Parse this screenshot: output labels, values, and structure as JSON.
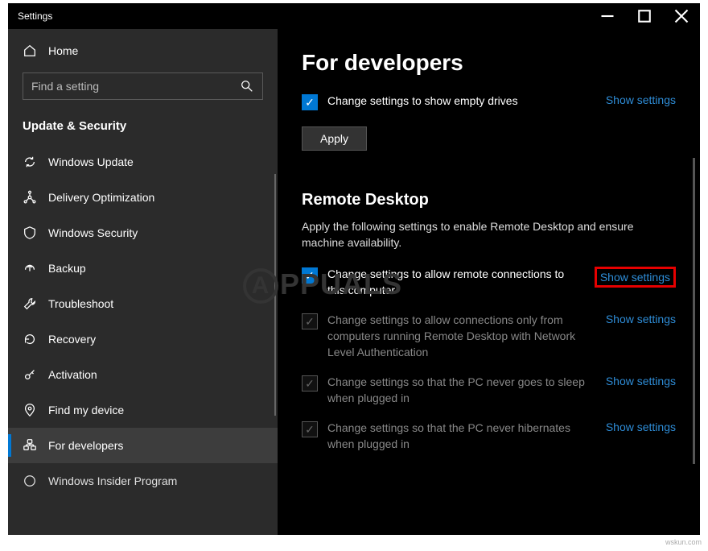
{
  "window": {
    "title": "Settings"
  },
  "sidebar": {
    "home": "Home",
    "search_placeholder": "Find a setting",
    "section": "Update & Security",
    "items": [
      {
        "label": "Windows Update"
      },
      {
        "label": "Delivery Optimization"
      },
      {
        "label": "Windows Security"
      },
      {
        "label": "Backup"
      },
      {
        "label": "Troubleshoot"
      },
      {
        "label": "Recovery"
      },
      {
        "label": "Activation"
      },
      {
        "label": "Find my device"
      },
      {
        "label": "For developers"
      },
      {
        "label": "Windows Insider Program"
      }
    ]
  },
  "content": {
    "heading": "For developers",
    "sec1_item1": "Change settings to show empty drives",
    "sec1_link1": "Show settings",
    "apply": "Apply",
    "rd_heading": "Remote Desktop",
    "rd_desc": "Apply the following settings to enable Remote Desktop and ensure machine availability.",
    "rd_item1": "Change settings to allow remote connections to this computer",
    "rd_link1": "Show settings",
    "rd_item2": "Change settings to allow connections only from computers running Remote Desktop with Network Level Authentication",
    "rd_link2": "Show settings",
    "rd_item3": "Change settings so that the PC never goes to sleep when plugged in",
    "rd_link3": "Show settings",
    "rd_item4": "Change settings so that the PC never hibernates when plugged in",
    "rd_link4": "Show settings"
  },
  "watermark": "PPUALS",
  "footer": "wskun.com"
}
